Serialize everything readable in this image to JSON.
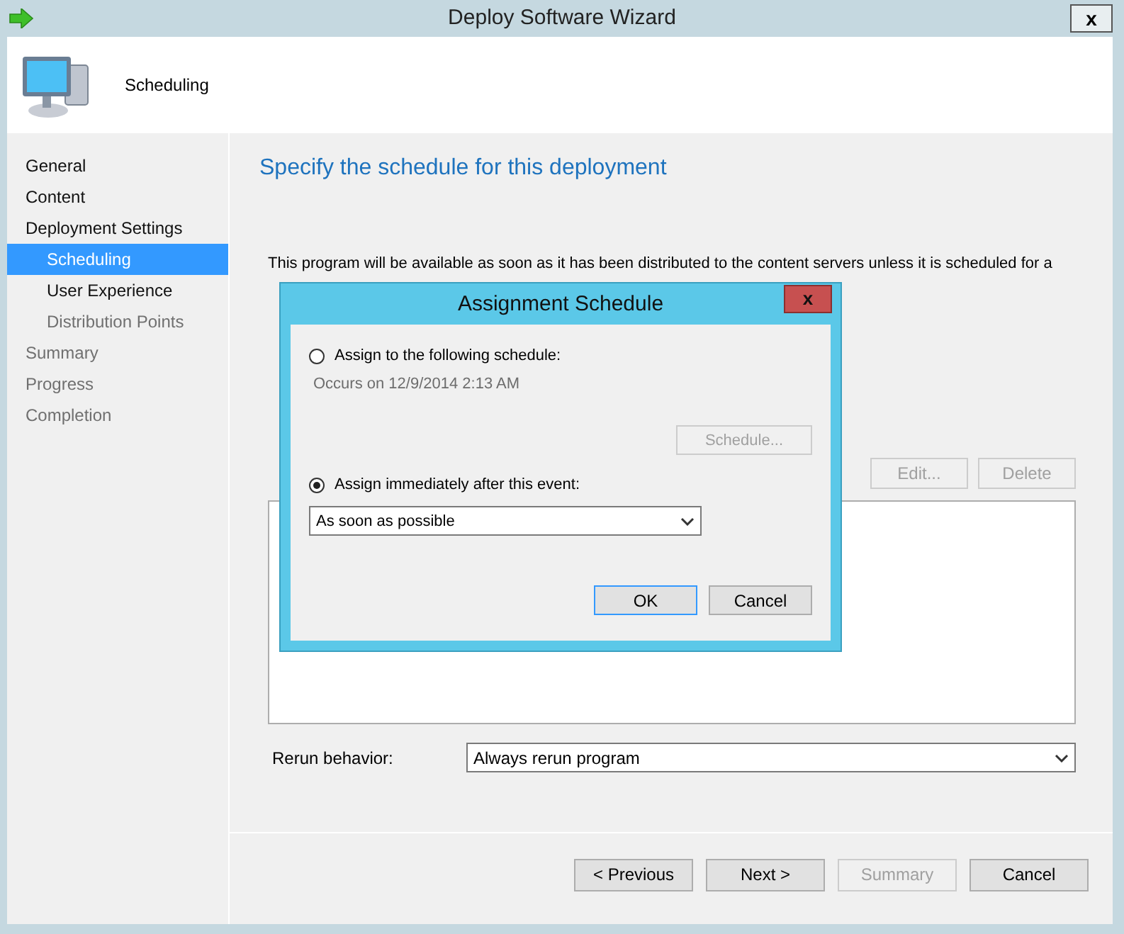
{
  "window": {
    "title": "Deploy Software Wizard",
    "close": "x"
  },
  "header": {
    "title": "Scheduling"
  },
  "sidebar": {
    "items": [
      {
        "label": "General",
        "selected": false,
        "disabled": false
      },
      {
        "label": "Content",
        "selected": false,
        "disabled": false
      },
      {
        "label": "Deployment Settings",
        "selected": false,
        "disabled": false,
        "children": [
          {
            "label": "Scheduling",
            "selected": true,
            "disabled": false
          },
          {
            "label": "User Experience",
            "selected": false,
            "disabled": false
          },
          {
            "label": "Distribution Points",
            "selected": false,
            "disabled": true
          }
        ]
      },
      {
        "label": "Summary",
        "selected": false,
        "disabled": true
      },
      {
        "label": "Progress",
        "selected": false,
        "disabled": true
      },
      {
        "label": "Completion",
        "selected": false,
        "disabled": true
      }
    ]
  },
  "page": {
    "heading": "Specify the schedule for this deployment",
    "description": "This program will be available as soon as it has been distributed to the content servers unless it is scheduled for a",
    "list_buttons": [
      {
        "label": "Edit...",
        "disabled": true
      },
      {
        "label": "Delete",
        "disabled": true
      }
    ],
    "rerun_label": "Rerun behavior:",
    "rerun_value": "Always rerun program"
  },
  "buttons": [
    {
      "label": "< Previous",
      "disabled": false
    },
    {
      "label": "Next >",
      "disabled": false
    },
    {
      "label": "Summary",
      "disabled": true
    },
    {
      "label": "Cancel",
      "disabled": false
    }
  ],
  "dialog": {
    "title": "Assignment Schedule",
    "close": "x",
    "options": [
      {
        "label": "Assign to the following schedule:",
        "selected": false
      },
      {
        "label": "Assign immediately after this event:",
        "selected": true
      }
    ],
    "occurs": "Occurs on 12/9/2014 2:13 AM",
    "schedule_button": {
      "label": "Schedule...",
      "disabled": true
    },
    "event_value": "As soon as possible",
    "buttons": [
      {
        "label": "OK",
        "default": true
      },
      {
        "label": "Cancel",
        "default": false
      }
    ]
  }
}
